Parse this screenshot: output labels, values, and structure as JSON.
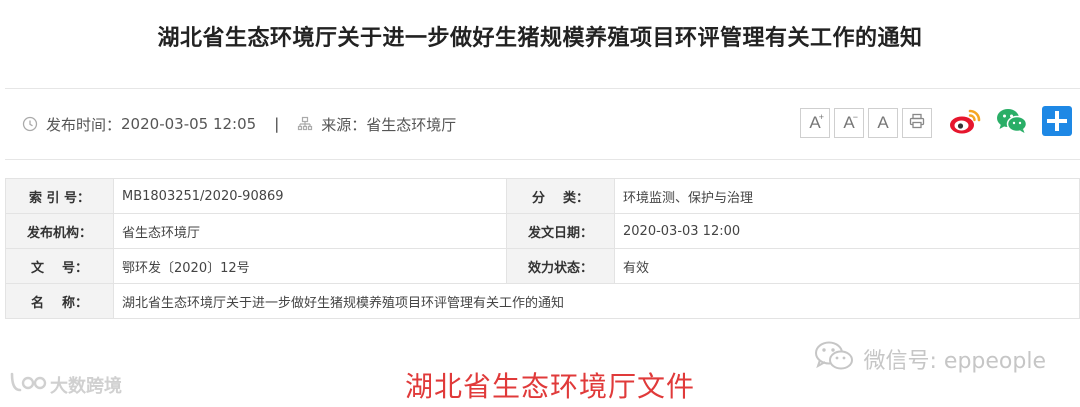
{
  "page": {
    "title": "湖北省生态环境厅关于进一步做好生猪规模养殖项目环评管理有关工作的通知"
  },
  "meta": {
    "publish_label": "发布时间：",
    "publish_time": "2020-03-05 12:05",
    "separator": "|",
    "source_label": "来源：",
    "source": "省生态环境厅"
  },
  "tools": {
    "font_increase": "A",
    "font_decrease": "A",
    "font_default": "A",
    "plus_mark": "+",
    "minus_mark": "−",
    "icons": [
      "print-icon",
      "weibo-icon",
      "wechat-icon",
      "share-plus-icon"
    ]
  },
  "info_table": {
    "rows": [
      {
        "label": "索 引 号：",
        "value": "MB1803251/2020-90869",
        "label2": "分    类：",
        "value2": "环境监测、保护与治理"
      },
      {
        "label": "发布机构：",
        "value": "省生态环境厅",
        "label2": "发文日期：",
        "value2": "2020-03-03 12:00"
      },
      {
        "label": "文    号：",
        "value": "鄂环发〔2020〕12号",
        "label2": "效力状态：",
        "value2": "有效"
      }
    ],
    "name_label": "名    称：",
    "name_value": "湖北省生态环境厅关于进一步做好生猪规模养殖项目环评管理有关工作的通知"
  },
  "watermarks": {
    "left": "大数跨境",
    "right": "微信号: eppeople"
  },
  "document_heading": "湖北省生态环境厅文件",
  "colors": {
    "heading_red": "#e03a3a",
    "weibo_red": "#e6162d",
    "weibo_orange": "#f5a623",
    "wechat_green": "#2aae67",
    "share_blue": "#1e88e5"
  }
}
